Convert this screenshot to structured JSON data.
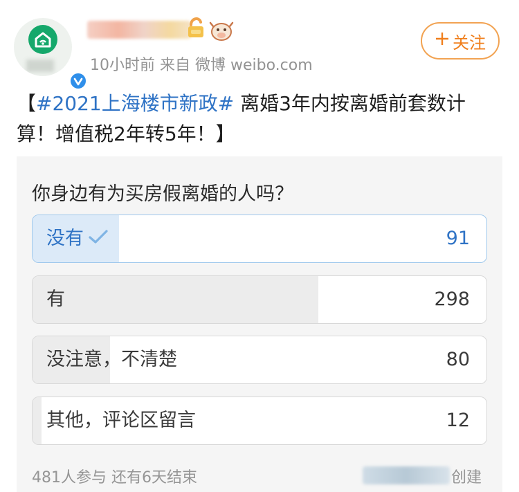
{
  "post": {
    "meta": "10小时前  来自 微博 weibo.com",
    "follow_label": "关注",
    "text_open": "【",
    "hashtag": "#2021上海楼市新政#",
    "text_body": " 离婚3年内按离婚前套数计算！增值税2年转5年！】"
  },
  "poll": {
    "question": "你身边有为买房假离婚的人吗？",
    "options": [
      {
        "label": "没有",
        "count": "91",
        "selected": true,
        "fraction": 0.19
      },
      {
        "label": "有",
        "count": "298",
        "selected": false,
        "fraction": 0.63
      },
      {
        "label": "没注意，不清楚",
        "count": "80",
        "selected": false,
        "fraction": 0.17
      },
      {
        "label": "其他，评论区留言",
        "count": "12",
        "selected": false,
        "fraction": 0.02
      }
    ],
    "footer": "481人参与  还有6天结束",
    "creator_suffix": "创建"
  },
  "colors": {
    "accent_orange": "#f07f1c",
    "link_blue": "#2f73c5",
    "verified_blue": "#2f8fea",
    "avatar_green": "#15a86b"
  }
}
